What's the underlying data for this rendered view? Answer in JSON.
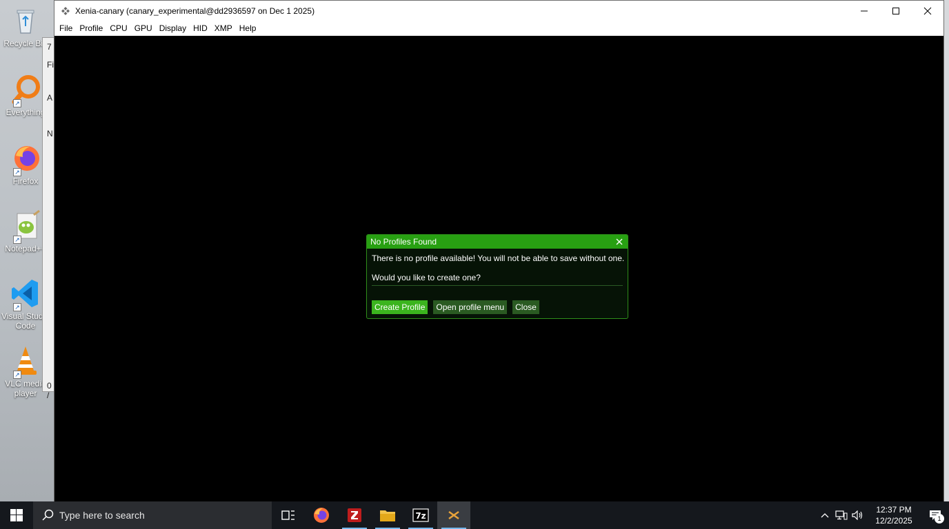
{
  "desktop": {
    "icons": [
      {
        "label": "Recycle Bin",
        "icon": "recycle-bin-icon"
      },
      {
        "label": "Everything",
        "icon": "everything-search-icon"
      },
      {
        "label": "Firefox",
        "icon": "firefox-icon"
      },
      {
        "label": "Notepad++",
        "icon": "notepad-plus-plus-icon"
      },
      {
        "label": "Visual Studio Code",
        "icon": "vscode-icon"
      },
      {
        "label": "VLC media player",
        "icon": "vlc-icon"
      }
    ]
  },
  "background_window": {
    "fragments": [
      "7",
      "Fi",
      "A",
      "N",
      "0 /"
    ]
  },
  "window": {
    "title": "Xenia-canary (canary_experimental@dd2936597 on Dec  1 2025)",
    "menu": [
      "File",
      "Profile",
      "CPU",
      "GPU",
      "Display",
      "HID",
      "XMP",
      "Help"
    ],
    "controls": {
      "minimize": "—",
      "maximize": "☐",
      "close": "✕"
    }
  },
  "dialog": {
    "title": "No Profiles Found",
    "close_glyph": "✕",
    "message_line1": "There is no profile available! You will not be able to save without one.",
    "message_line2": "Would you like to create one?",
    "buttons": {
      "create": "Create Profile",
      "open_menu": "Open profile menu",
      "close": "Close"
    },
    "accent_color": "#28a012",
    "button_color": "#3bb41e"
  },
  "taskbar": {
    "search_placeholder": "Type here to search",
    "apps": [
      "task-view-icon",
      "firefox-icon",
      "filezilla-icon",
      "file-explorer-icon",
      "7zip-icon",
      "xenia-icon"
    ],
    "clock_time": "12:37 PM",
    "clock_date": "12/2/2025",
    "notification_count": "1"
  }
}
